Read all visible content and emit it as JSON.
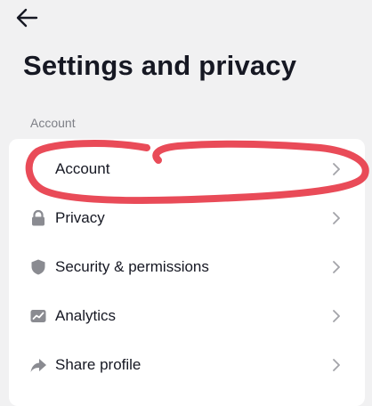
{
  "header": {
    "back_icon": "arrow-left-icon",
    "title": "Settings and privacy"
  },
  "section": {
    "label": "Account"
  },
  "items": [
    {
      "label": "Account",
      "icon": "person-icon"
    },
    {
      "label": "Privacy",
      "icon": "lock-icon"
    },
    {
      "label": "Security & permissions",
      "icon": "shield-icon"
    },
    {
      "label": "Analytics",
      "icon": "chart-icon"
    },
    {
      "label": "Share profile",
      "icon": "share-icon"
    }
  ],
  "annotation": {
    "type": "hand-drawn circle",
    "color": "#e8414f",
    "target": "Account"
  },
  "colors": {
    "background": "#f1f1f2",
    "card": "#ffffff",
    "text": "#161823",
    "muted": "#7d7f86",
    "icon": "#8a8b91"
  }
}
